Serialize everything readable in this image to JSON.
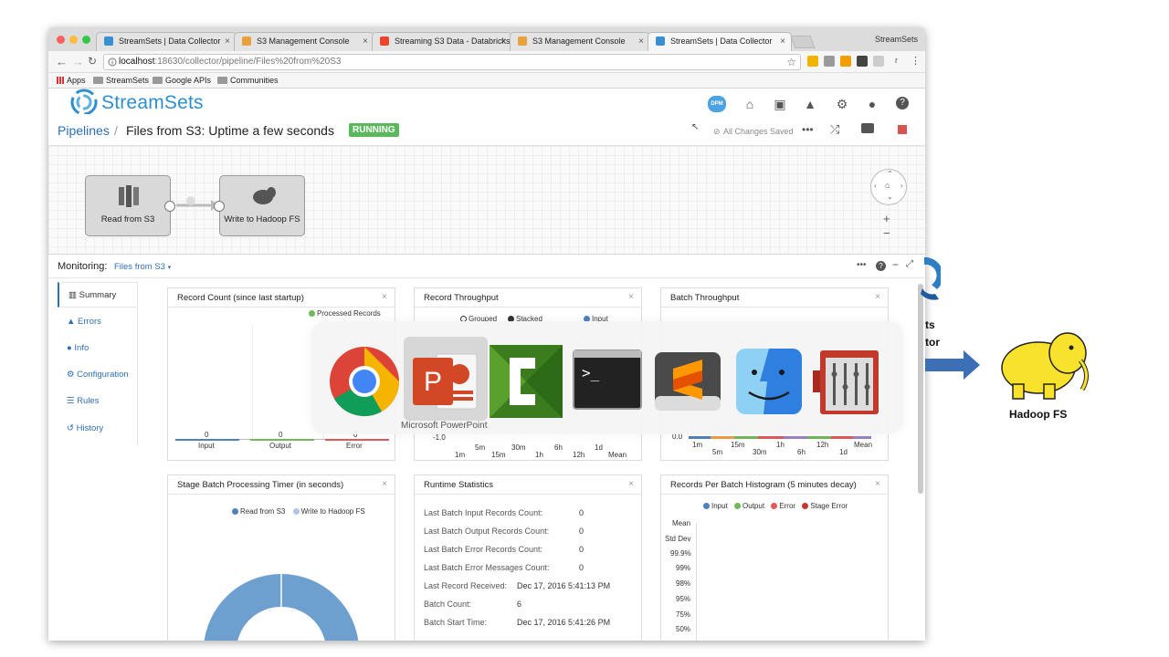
{
  "browser": {
    "tabs": [
      {
        "label": "StreamSets | Data Collector",
        "close": "×"
      },
      {
        "label": "S3 Management Console",
        "close": "×"
      },
      {
        "label": "Streaming S3 Data - Databricks",
        "close": "×"
      },
      {
        "label": "S3 Management Console",
        "close": "×"
      },
      {
        "label": "StreamSets | Data Collector",
        "close": "×"
      }
    ],
    "profile_name": "StreamSets",
    "url_host": "localhost",
    "url_path": ":18630/collector/pipeline/Files%20from%20S3",
    "bookmarks": {
      "apps": "Apps",
      "b1": "StreamSets",
      "b2": "Google APIs",
      "b3": "Communities"
    },
    "extension_extra": "r",
    "menu_dots": "⋮"
  },
  "app": {
    "logo_text": "StreamSets",
    "dpm_label": "DPM",
    "breadcrumb": {
      "root": "Pipelines",
      "separator": "/",
      "title": "Files from S3:  Uptime  a few seconds"
    },
    "status": "RUNNING",
    "save_status": "All Changes Saved",
    "stages": [
      {
        "label": "Read from S3"
      },
      {
        "label": "Write to Hadoop FS"
      }
    ],
    "zoom_in": "+",
    "zoom_out": "−"
  },
  "monitoring": {
    "label": "Monitoring:",
    "pipeline": "Files from S3",
    "nav": [
      {
        "label": "Summary"
      },
      {
        "label": "Errors"
      },
      {
        "label": "Info"
      },
      {
        "label": "Configuration"
      },
      {
        "label": "Rules"
      },
      {
        "label": "History"
      }
    ],
    "panels": {
      "record_count": {
        "title": "Record Count (since last startup)",
        "legend": "Processed Records",
        "bars": [
          {
            "label": "Input",
            "value": "0"
          },
          {
            "label": "Output",
            "value": "0"
          },
          {
            "label": "Error",
            "value": "0"
          }
        ]
      },
      "record_throughput": {
        "title": "Record Throughput",
        "options": [
          "Grouped",
          "Stacked"
        ],
        "legend": "Input",
        "y_min": "-1.0",
        "x_ticks": [
          "1m",
          "5m",
          "15m",
          "30m",
          "1h",
          "6h",
          "12h",
          "1d",
          "Mean"
        ]
      },
      "batch_throughput": {
        "title": "Batch Throughput",
        "y_min": "0.0",
        "x_ticks": [
          "1m",
          "5m",
          "15m",
          "30m",
          "1h",
          "6h",
          "12h",
          "1d",
          "Mean"
        ]
      },
      "stage_timer": {
        "title": "Stage Batch Processing Timer (in seconds)",
        "legend": [
          "Read from S3",
          "Write to Hadoop FS"
        ],
        "colors": {
          "read": "#4f81bd",
          "write": "#aec7e8"
        }
      },
      "runtime_stats": {
        "title": "Runtime Statistics",
        "rows": [
          {
            "label": "Last Batch Input Records Count:",
            "value": "0"
          },
          {
            "label": "Last Batch Output Records Count:",
            "value": "0"
          },
          {
            "label": "Last Batch Error Records Count:",
            "value": "0"
          },
          {
            "label": "Last Batch Error Messages Count:",
            "value": "0"
          },
          {
            "label": "Last Record Received:",
            "value": "Dec 17, 2016 5:41:13 PM"
          },
          {
            "label": "Batch Count:",
            "value": "6"
          },
          {
            "label": "Batch Start Time:",
            "value": "Dec 17, 2016 5:41:26 PM"
          }
        ]
      },
      "histogram": {
        "title": "Records Per Batch Histogram (5 minutes decay)",
        "legend": [
          "Input",
          "Output",
          "Error",
          "Stage Error"
        ],
        "colors": [
          "#4f81bd",
          "#70b85a",
          "#e05a5a",
          "#c0392b"
        ],
        "rows": [
          "Mean",
          "Std Dev",
          "99.9%",
          "99%",
          "98%",
          "95%",
          "75%",
          "50%"
        ]
      }
    },
    "close": "×"
  },
  "switcher": {
    "selected_app": "Microsoft PowerPoint",
    "apps": [
      "chrome-icon",
      "powerpoint-icon",
      "camtasia-icon",
      "terminal-icon",
      "sublime-icon",
      "finder-icon",
      "keychain-icon"
    ]
  },
  "diagram": {
    "partial_label_1": "ts",
    "partial_label_2": "tor",
    "target_label": "Hadoop FS"
  }
}
